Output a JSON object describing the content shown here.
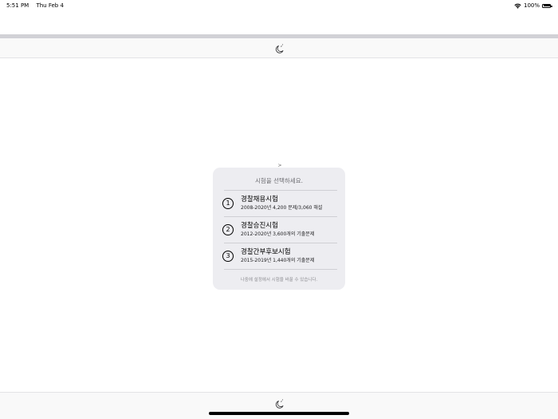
{
  "status_bar": {
    "time": "5:51 PM",
    "date": "Thu Feb 4",
    "battery": "100%",
    "wifi_icon": "wifi-icon",
    "battery_icon": "battery-icon"
  },
  "toolbar": {
    "sleep_icon": "moon-zzz-icon"
  },
  "popover": {
    "arrow": ">",
    "title": "시험을 선택하세요.",
    "options": [
      {
        "number": "1",
        "title": "경찰채용시험",
        "subtitle": "2008-2020년 4,200 문제/3,060 해설"
      },
      {
        "number": "2",
        "title": "경찰승진시험",
        "subtitle": "2012-2020년 3,600개의 기출문제"
      },
      {
        "number": "3",
        "title": "경찰간부후보시험",
        "subtitle": "2015-2019년 1,440개의 기출문제"
      }
    ],
    "footer": "나중에 설정에서 시험을 바꿀 수 있습니다."
  },
  "colors": {
    "popover_background": "#ededf1",
    "toolbar_background": "#f9f9f9",
    "band": "#d1d1d6",
    "secondary_text": "#6e6e73"
  }
}
